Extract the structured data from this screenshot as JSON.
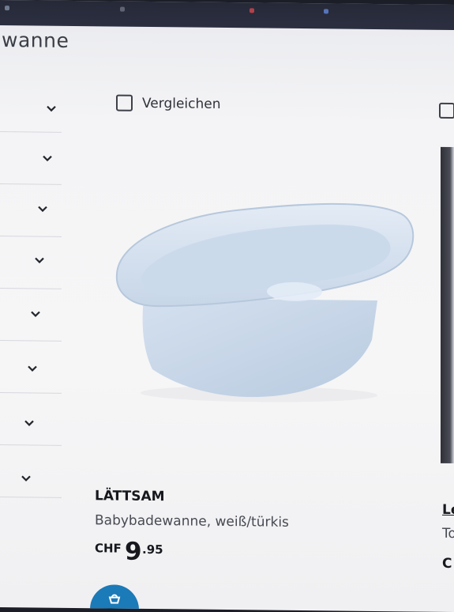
{
  "page": {
    "title": "wanne"
  },
  "filters": {
    "items": [
      {
        "id": 1
      },
      {
        "id": 2
      },
      {
        "id": 3
      },
      {
        "id": 4
      },
      {
        "id": 5
      },
      {
        "id": 6
      },
      {
        "id": 7
      },
      {
        "id": 8
      }
    ]
  },
  "product": {
    "compare_label": "Vergleichen",
    "name": "LÄTTSAM",
    "description": "Babybadewanne, weiß/türkis",
    "price_currency": "CHF",
    "price_integer": "9",
    "price_decimal": ".95"
  },
  "next_product": {
    "name_fragment": "Le",
    "description_fragment": "To",
    "price_fragment": "C"
  },
  "colors": {
    "accent_blue": "#1b7ab8",
    "tub_color": "#cfdceb"
  },
  "icons": {
    "chevron": "chevron-down-icon",
    "cart": "shopping-bag-icon"
  }
}
